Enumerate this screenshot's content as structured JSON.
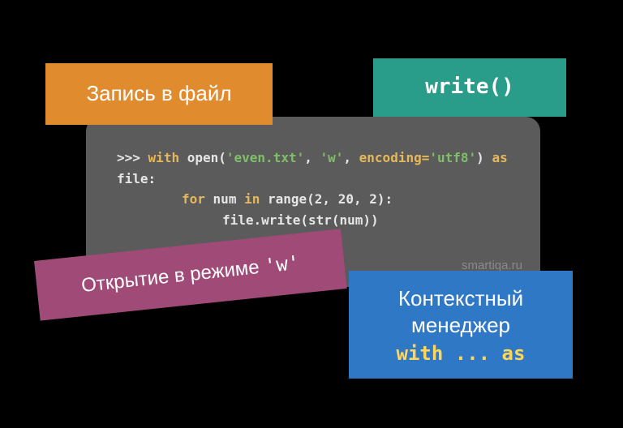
{
  "code": {
    "prompt": ">>>",
    "kw_with": "with",
    "fn_open": "open(",
    "str_file": "'even.txt'",
    "comma1": ", ",
    "str_mode": "'w'",
    "comma2": ", ",
    "arg_enc": "encoding=",
    "str_enc": "'utf8'",
    "close_paren": ")",
    "kw_as": "as",
    "var_file": "file:",
    "kw_for": "for",
    "var_num": "num",
    "kw_in": "in",
    "fn_range": "range(2, 20, 2):",
    "line3": "file.write(str(num))"
  },
  "attribution": "smartiqa.ru",
  "labels": {
    "orange": "Запись в файл",
    "teal": "write()",
    "purple_prefix": "Открытие в режиме ",
    "purple_mode": "'w'",
    "blue_line1": "Контекстный",
    "blue_line2": "менеджер",
    "blue_code": "with ... as"
  }
}
